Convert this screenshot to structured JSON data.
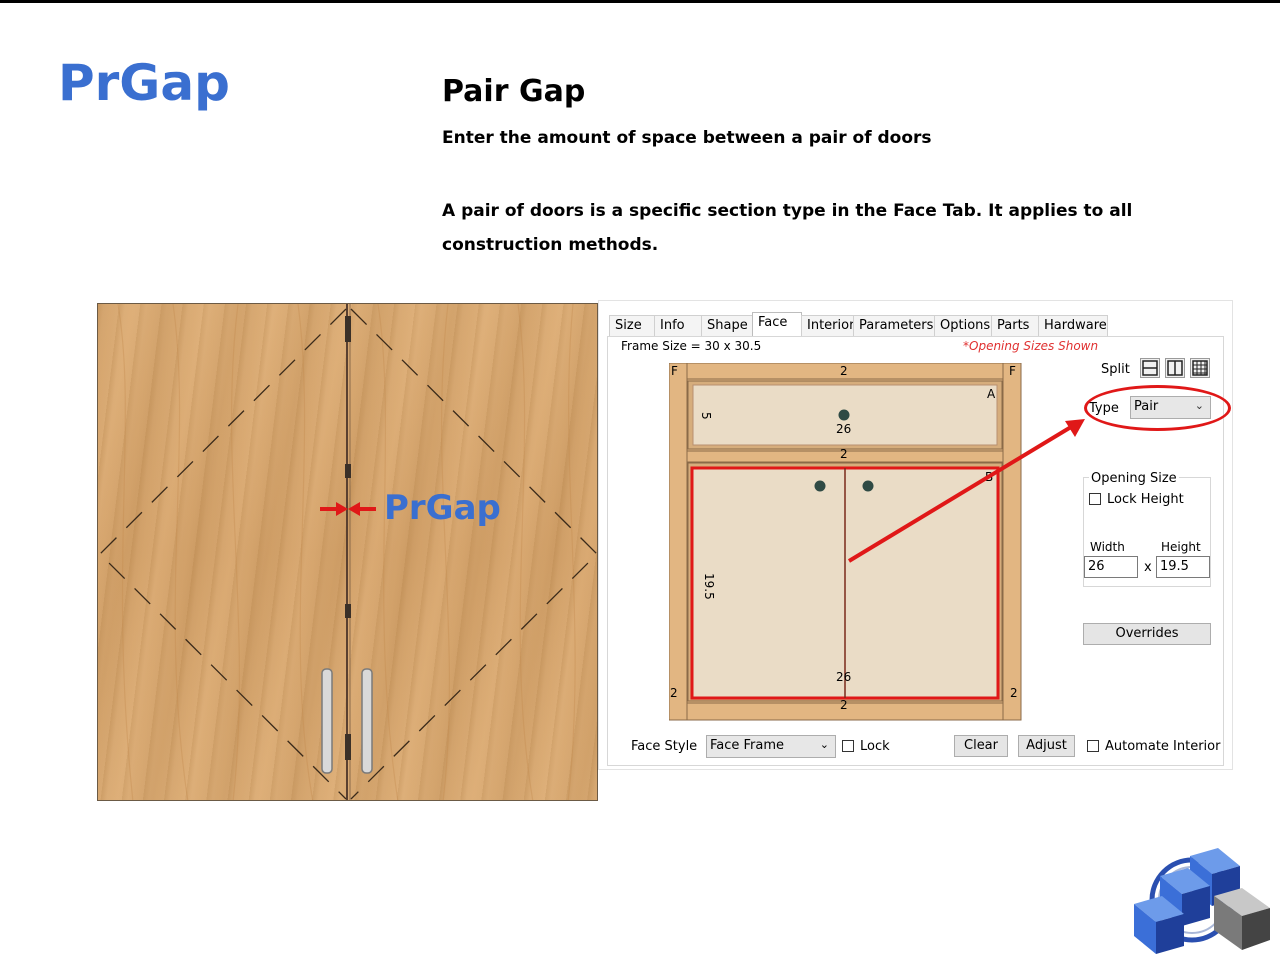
{
  "slide": {
    "brand": "PrGap",
    "title": "Pair Gap",
    "subtitle": "Enter the amount of space between a pair of doors",
    "description": "A pair of doors is a specific section type in the Face Tab. It applies to all construction methods."
  },
  "door_image": {
    "gap_label": "PrGap"
  },
  "dialog": {
    "tabs": [
      {
        "label": "Size"
      },
      {
        "label": "Info"
      },
      {
        "label": "Shape"
      },
      {
        "label": "Face"
      },
      {
        "label": "Interior"
      },
      {
        "label": "Parameters"
      },
      {
        "label": "Options"
      },
      {
        "label": "Parts"
      },
      {
        "label": "Hardware"
      }
    ],
    "active_tab": "Face",
    "frame_size": "Frame Size = 30 x 30.5",
    "opening_note": "*Opening Sizes Shown",
    "split_label": "Split",
    "type_label": "Type",
    "type_value": "Pair",
    "opening_size": {
      "title": "Opening Size",
      "lock_height_label": "Lock Height",
      "width_label": "Width",
      "height_label": "Height",
      "width_value": "26",
      "height_value": "19.5",
      "times": "x"
    },
    "overrides_label": "Overrides",
    "face_style_label": "Face Style",
    "face_style_value": "Face Frame",
    "lock_label": "Lock",
    "clear_label": "Clear",
    "adjust_label": "Adjust",
    "automate_interior_label": "Automate Interior",
    "cabinet": {
      "corner_left": "F",
      "corner_right": "F",
      "top_rail": "2",
      "mid_rail": "2",
      "bottom_rail": "2",
      "left_stile": "2",
      "right_stile": "2",
      "section_a": "A",
      "section_b": "B",
      "drawer_height": "5",
      "drawer_width": "26",
      "door_height": "19.5",
      "door_width": "26"
    }
  },
  "colors": {
    "brand_blue": "#3a6fd0",
    "highlight_red": "#e01818",
    "frame_wood": "#e2b682",
    "panel_fill": "#eadcc6"
  }
}
